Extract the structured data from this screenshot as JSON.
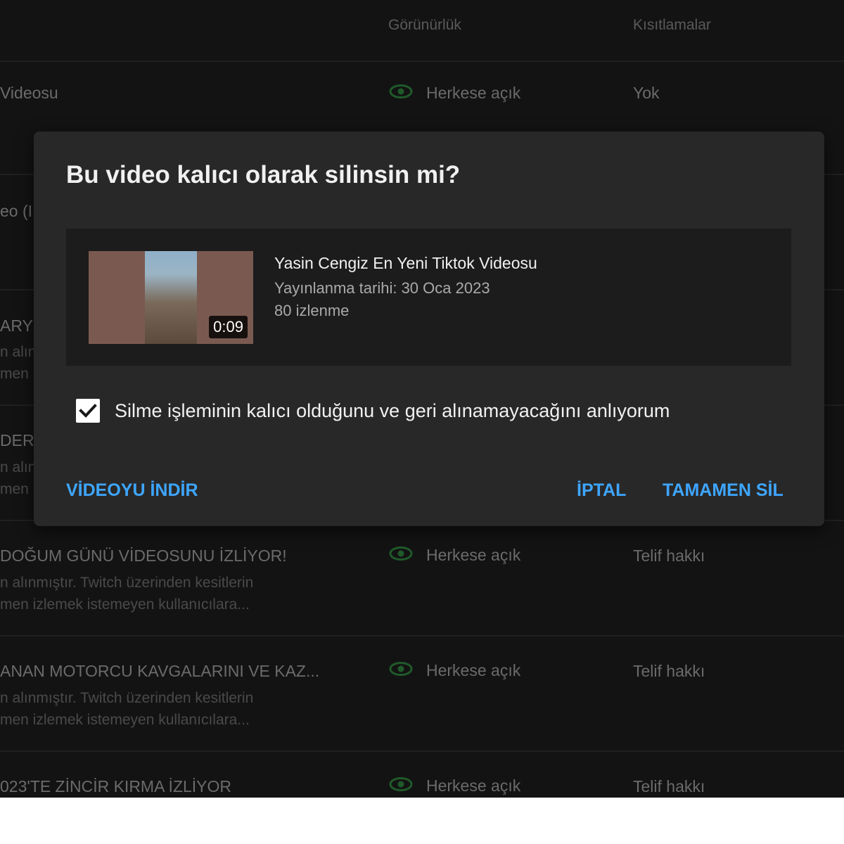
{
  "table": {
    "headers": {
      "visibility": "Görünürlük",
      "restrictions": "Kısıtlamalar"
    },
    "rows": [
      {
        "title": "Videosu",
        "desc1": "",
        "desc2": "",
        "visibility": "Herkese açık",
        "restriction": "Yok"
      },
      {
        "title": "eo (I",
        "desc1": "",
        "desc2": "",
        "visibility": "",
        "restriction": ""
      },
      {
        "title": "ARYU",
        "desc1": "n alın",
        "desc2": "men",
        "visibility": "",
        "restriction": ""
      },
      {
        "title": "DERİ",
        "desc1": "n alın",
        "desc2": "men",
        "visibility": "",
        "restriction": ""
      },
      {
        "title": "DOĞUM GÜNÜ VİDEOSUNU İZLİYOR!",
        "desc1": "n alınmıştır. Twitch üzerinden kesitlerin",
        "desc2": "men izlemek istemeyen kullanıcılara...",
        "visibility": "Herkese açık",
        "restriction": "Telif hakkı"
      },
      {
        "title": "ANAN MOTORCU KAVGALARINI VE KAZ...",
        "desc1": "n alınmıştır. Twitch üzerinden kesitlerin",
        "desc2": "men izlemek istemeyen kullanıcılara...",
        "visibility": "Herkese açık",
        "restriction": "Telif hakkı"
      },
      {
        "title": "023'TE ZİNCİR KIRMA İZLİYOR",
        "desc1": "",
        "desc2": "",
        "visibility": "Herkese açık",
        "restriction": "Telif hakkı"
      }
    ]
  },
  "dialog": {
    "title": "Bu video kalıcı olarak silinsin mi?",
    "video": {
      "title": "Yasin Cengiz En Yeni Tiktok Videosu",
      "published": "Yayınlanma tarihi: 30 Oca 2023",
      "views": "80 izlenme",
      "duration": "0:09"
    },
    "checkbox_label": "Silme işleminin kalıcı olduğunu ve geri alınamayacağını anlıyorum",
    "checkbox_checked": true,
    "download_label": "VİDEOYU İNDİR",
    "cancel_label": "İPTAL",
    "delete_label": "TAMAMEN SİL"
  },
  "colors": {
    "accent": "#3ea6ff",
    "visibility_icon": "#1f5a2a",
    "dialog_bg": "#282828",
    "page_bg": "#131313"
  },
  "icons": {
    "visibility": "eye-icon",
    "checkbox": "checkmark-icon"
  }
}
